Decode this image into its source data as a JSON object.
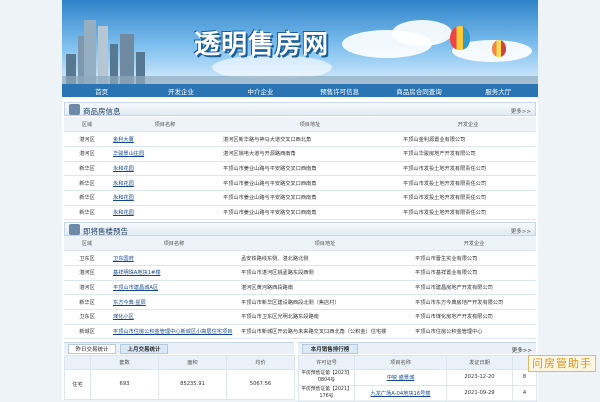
{
  "header": {
    "logo_text": "透明售房网"
  },
  "nav": {
    "items": [
      "首页",
      "开发企业",
      "中介企业",
      "预售许可信息",
      "商品房合同查询",
      "服务大厅"
    ]
  },
  "listing": {
    "title": "商品房信息",
    "more": "更多>>",
    "columns": [
      "区域",
      "项目名称",
      "项目地址",
      "开发企业"
    ],
    "rows": [
      [
        "湛河区",
        "金利大厦",
        "湛河区新华路与神马大道交叉口西北角",
        "平顶山金利源置业有限公司"
      ],
      [
        "湛河区",
        "华骏景山庄园",
        "湛河区姚电大道与开源路西南角",
        "平顶山华骏房地产开发有限公司"
      ],
      [
        "新华区",
        "永和花园",
        "平顶山市姜业山路与平安路交叉口西南角",
        "平顶山市发投土地开发有限责任公司"
      ],
      [
        "新华区",
        "永和花园",
        "平顶山市姜业山路与平安路交叉口西南角",
        "平顶山市发投土地开发有限责任公司"
      ],
      [
        "新华区",
        "永和花园",
        "平顶山市姜业山路与平安路交叉口西南角",
        "平顶山市发投土地开发有限责任公司"
      ],
      [
        "新华区",
        "永和花园",
        "平顶山市姜业山路与平安路交叉口西南角",
        "平顶山市发投土地开发有限责任公司"
      ]
    ]
  },
  "presale": {
    "title": "即将售楼预告",
    "more": "更多>>",
    "columns": [
      "区域",
      "项目名称",
      "项目地址",
      "开发企业"
    ],
    "rows": [
      [
        "卫东区",
        "卫东国府",
        "孟安铁路线东侧、湛北路北侧",
        "平顶山市晋生实业有限公司"
      ],
      [
        "湛河区",
        "基祥明珠A地块1#楼",
        "平顶山市湛河区姚孟路东段西侧",
        "平顶山市基祥置业有限公司"
      ],
      [
        "湛河区",
        "平顶山市建昌城A区",
        "湛河区黄河路西段路南",
        "平顶山市建昌房地产开发有限公司"
      ],
      [
        "新华区",
        "东方今典·星辰",
        "平顶山市新华区建设路西段北侧（焦店村）",
        "平顶山市东方今典房地产开发有限公司"
      ],
      [
        "卫东区",
        "煤化小区",
        "平顶山市卫东区光明北路东段路南",
        "平顶山市煤化房地产开发有限公司"
      ],
      [
        "新城区",
        "平顶山市住房公积金管理中心新城区小高层住宅项目",
        "平顶山市新城区开云路与未来路交叉口西北角（公积金）住宅楼",
        "平顶山市住房公积金管理中心"
      ]
    ]
  },
  "stats": {
    "tabs": [
      "昨日交易统计",
      "上月交易统计"
    ],
    "columns": [
      "",
      "套数",
      "面积",
      "均价"
    ],
    "row": [
      "住宅",
      "693",
      "85235.91",
      "5067.56"
    ]
  },
  "ranking": {
    "tab": "本月销售排行榜",
    "more": "更多>>",
    "columns": [
      "许可证号",
      "项目名称",
      "发证日期",
      ""
    ],
    "rows": [
      [
        "平房预售证第【2023】0804号",
        "中锐·盛景城",
        "2023-12-20",
        "8"
      ],
      [
        "平房预售证第【2021】176号",
        "九龙广场A-04地块16号楼",
        "2021-09-29",
        "4"
      ]
    ]
  },
  "assistant": {
    "label": "问房管助手"
  }
}
